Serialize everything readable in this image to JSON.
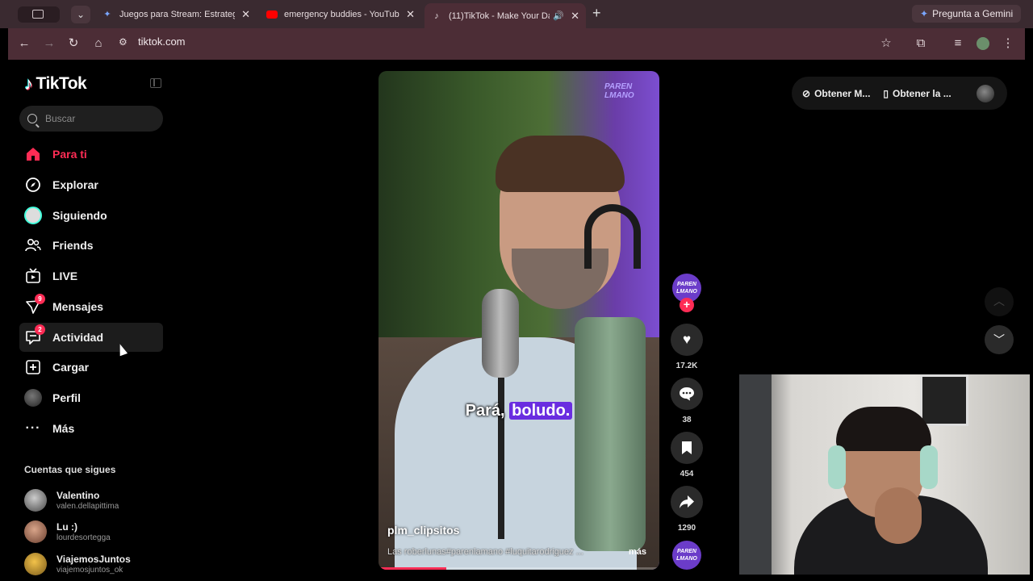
{
  "browser": {
    "tabs": [
      {
        "title": "Juegos para Stream: Estrateg",
        "favicon": "gemini-star-icon"
      },
      {
        "title": "emergency buddies - YouTub",
        "favicon": "youtube-icon"
      },
      {
        "title": "(11)TikTok - Make Your Da",
        "favicon": "tiktok-icon"
      }
    ],
    "gemini_label": "Pregunta a Gemini",
    "url": "tiktok.com"
  },
  "sidebar": {
    "logo": "TikTok",
    "search_placeholder": "Buscar",
    "items": [
      {
        "label": "Para ti",
        "icon": "home-icon"
      },
      {
        "label": "Explorar",
        "icon": "compass-icon"
      },
      {
        "label": "Siguiendo",
        "icon": "following-icon"
      },
      {
        "label": "Friends",
        "icon": "friends-icon"
      },
      {
        "label": "LIVE",
        "icon": "live-icon"
      },
      {
        "label": "Mensajes",
        "icon": "messages-icon",
        "badge": "9"
      },
      {
        "label": "Actividad",
        "icon": "activity-icon",
        "badge": "2"
      },
      {
        "label": "Cargar",
        "icon": "upload-icon"
      },
      {
        "label": "Perfil",
        "icon": "profile-avatar"
      },
      {
        "label": "Más",
        "icon": "more-icon"
      }
    ],
    "following_title": "Cuentas que sigues",
    "following": [
      {
        "name": "Valentino",
        "handle": "valen.dellapittima"
      },
      {
        "name": "Lu :)",
        "handle": "lourdesortegga"
      },
      {
        "name": "ViajemosJuntos",
        "handle": "viajemosjuntos_ok"
      }
    ]
  },
  "video": {
    "brand_text": "PAREN LMANO",
    "caption_word1": "Pará,",
    "caption_word2": "boludo.",
    "username": "plm_clipsitos",
    "description": "Las roberlunas#parenlamano #luquitarodriguez ...",
    "more_label": "más",
    "progress": 0.24,
    "likes": "17.2K",
    "comments": "38",
    "saves": "454",
    "shares": "1290"
  },
  "topright": {
    "button1": "Obtener M...",
    "button2": "Obtener la ..."
  },
  "colors": {
    "accent": "#fe2c55",
    "tab_active": "#4c2d36"
  }
}
